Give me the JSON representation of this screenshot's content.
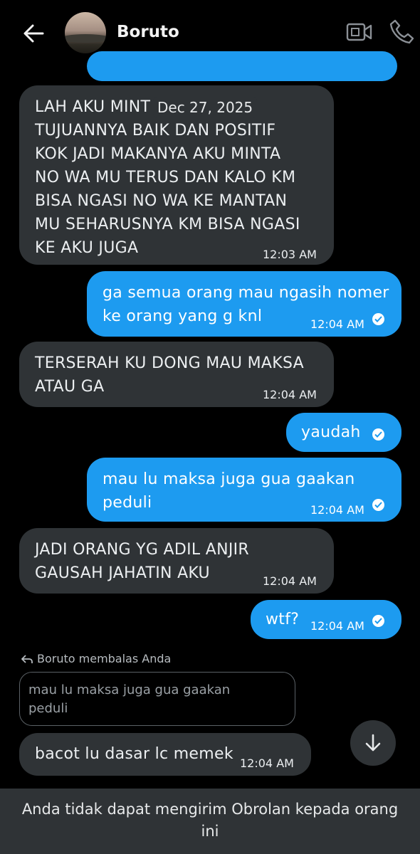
{
  "header": {
    "title": "Boruto",
    "back_icon": "back-arrow-icon",
    "video_icon": "video-call-icon",
    "call_icon": "phone-icon"
  },
  "date_separator": "Dec 27, 2025",
  "messages": [
    {
      "direction": "in",
      "text": "LAH AKU MINT\nTUJUANNYA BAIK DAN POSITIF\nKOK JADI MAKANYA AKU MINTA\nNO WA MU TERUS DAN KALO KM\nBISA NGASI NO WA KE MANTAN\nMU SEHARUSNYA KM BISA NGASI\nKE AKU JUGA",
      "time": "12:03 AM"
    },
    {
      "direction": "out",
      "text": "ga semua orang mau ngasih nomer\nke orang yang g knl",
      "time": "12:04 AM"
    },
    {
      "direction": "in",
      "text": "TERSERAH KU DONG MAU MAKSA\nATAU GA",
      "time": "12:04 AM"
    },
    {
      "direction": "out",
      "text": "yaudah",
      "time": ""
    },
    {
      "direction": "out",
      "text": "mau lu maksa juga gua gaakan\npeduli",
      "time": "12:04 AM"
    },
    {
      "direction": "in",
      "text": "JADI ORANG YG ADIL ANJIR\nGAUSAH JAHATIN AKU",
      "time": "12:04 AM"
    },
    {
      "direction": "out",
      "text": "wtf?",
      "time": "12:04 AM"
    },
    {
      "direction": "in",
      "text": "bacot lu dasar lc memek",
      "time": "12:04 AM"
    }
  ],
  "reply": {
    "label": "Boruto membalas Anda",
    "quoted_text": "mau lu maksa juga gua gaakan\npeduli"
  },
  "footer": {
    "notice": "Anda tidak dapat mengirim Obrolan kepada orang ini"
  },
  "colors": {
    "background": "#000000",
    "incoming_bubble": "#2f3336",
    "outgoing_bubble": "#1d9bf0"
  }
}
